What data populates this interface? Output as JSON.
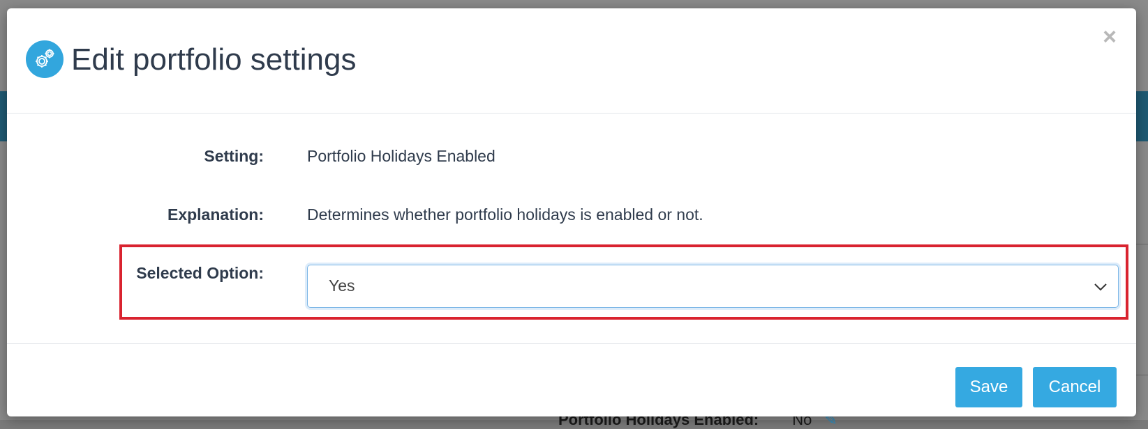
{
  "modal": {
    "title": "Edit portfolio settings",
    "close_label": "×",
    "header_icon": "gears-icon",
    "accent_color": "#35a9e1",
    "highlight_color": "#d9232f"
  },
  "form": {
    "setting_label": "Setting:",
    "setting_value": "Portfolio Holidays Enabled",
    "explanation_label": "Explanation:",
    "explanation_value": "Determines whether portfolio holidays is enabled or not.",
    "selected_option_label": "Selected Option:",
    "selected_option_value": "Yes"
  },
  "footer": {
    "save_label": "Save",
    "cancel_label": "Cancel"
  },
  "background": {
    "peek_label": "Portfolio Holidays Enabled:",
    "peek_value": "No"
  }
}
